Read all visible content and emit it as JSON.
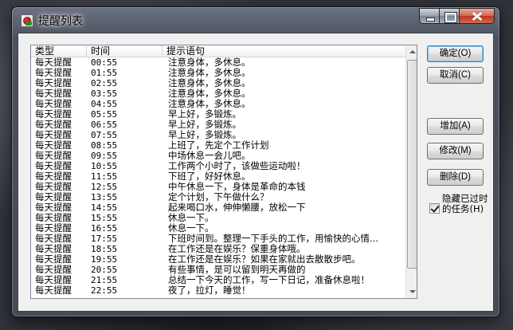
{
  "window": {
    "title": "提醒列表"
  },
  "list": {
    "columns": [
      "类型",
      "时间",
      "提示语句"
    ],
    "rows": [
      [
        "每天提醒",
        "00:55",
        "注意身体，多休息。"
      ],
      [
        "每天提醒",
        "01:55",
        "注意身体，多休息。"
      ],
      [
        "每天提醒",
        "02:55",
        "注意身体，多休息。"
      ],
      [
        "每天提醒",
        "03:55",
        "注意身体，多休息。"
      ],
      [
        "每天提醒",
        "04:55",
        "注意身体，多休息。"
      ],
      [
        "每天提醒",
        "05:55",
        "早上好，多锻炼。"
      ],
      [
        "每天提醒",
        "06:55",
        "早上好，多锻炼。"
      ],
      [
        "每天提醒",
        "07:55",
        "早上好，多锻炼。"
      ],
      [
        "每天提醒",
        "08:55",
        "上班了，先定个工作计划"
      ],
      [
        "每天提醒",
        "09:55",
        "中场休息一会儿吧。"
      ],
      [
        "每天提醒",
        "10:55",
        "工作两个小时了，该做些运动啦！"
      ],
      [
        "每天提醒",
        "11:55",
        "下班了，好好休息。"
      ],
      [
        "每天提醒",
        "12:55",
        "中午休息一下，身体是革命的本钱"
      ],
      [
        "每天提醒",
        "13:55",
        "定个计划，下午做什么？"
      ],
      [
        "每天提醒",
        "14:55",
        "起来喝口水，伸伸懒腰，放松一下"
      ],
      [
        "每天提醒",
        "15:55",
        "休息一下。"
      ],
      [
        "每天提醒",
        "16:55",
        "休息一下。"
      ],
      [
        "每天提醒",
        "17:55",
        "下班时间到。整理一下手头的工作，用愉快的心情..."
      ],
      [
        "每天提醒",
        "18:55",
        "在工作还是在娱乐？保重身体哦。"
      ],
      [
        "每天提醒",
        "19:55",
        "在工作还是在娱乐？如果在家就出去散散步吧。"
      ],
      [
        "每天提醒",
        "20:55",
        "有些事情，是可以留到明天再做的"
      ],
      [
        "每天提醒",
        "21:55",
        "总结一下今天的工作，写一下日记，准备休息啦！"
      ],
      [
        "每天提醒",
        "22:55",
        "夜了，拉灯，睡觉！"
      ]
    ]
  },
  "buttons": {
    "ok": "确定(O)",
    "cancel": "取消(C)",
    "add": "增加(A)",
    "modify": "修改(M)",
    "delete": "删除(D)"
  },
  "checkbox": {
    "label": "隐藏已过时的任务(H)",
    "checked": true
  }
}
